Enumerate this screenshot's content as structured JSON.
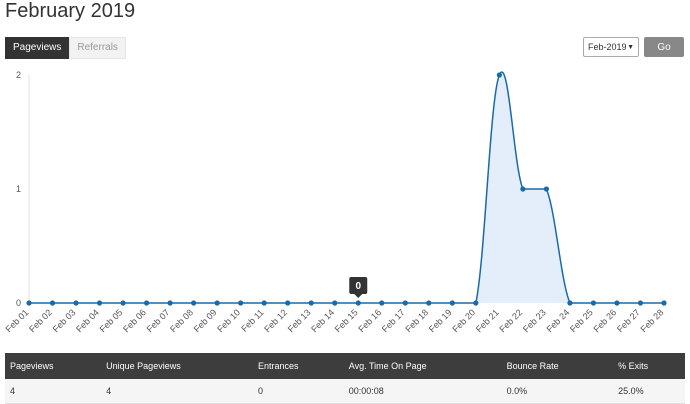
{
  "page": {
    "title": "February 2019"
  },
  "tabs": [
    {
      "label": "Pageviews",
      "active": true
    },
    {
      "label": "Referrals",
      "active": false
    }
  ],
  "controls": {
    "month_select_value": "Feb-2019",
    "go_label": "Go"
  },
  "tooltip": {
    "value": "0"
  },
  "chart_data": {
    "type": "area",
    "categories": [
      "Feb 01",
      "Feb 02",
      "Feb 03",
      "Feb 04",
      "Feb 05",
      "Feb 06",
      "Feb 07",
      "Feb 08",
      "Feb 09",
      "Feb 10",
      "Feb 11",
      "Feb 12",
      "Feb 13",
      "Feb 14",
      "Feb 15",
      "Feb 16",
      "Feb 17",
      "Feb 18",
      "Feb 19",
      "Feb 20",
      "Feb 21",
      "Feb 22",
      "Feb 23",
      "Feb 24",
      "Feb 25",
      "Feb 26",
      "Feb 27",
      "Feb 28"
    ],
    "values": [
      0,
      0,
      0,
      0,
      0,
      0,
      0,
      0,
      0,
      0,
      0,
      0,
      0,
      0,
      0,
      0,
      0,
      0,
      0,
      0,
      2,
      1,
      1,
      0,
      0,
      0,
      0,
      0
    ],
    "ylim": [
      0,
      2
    ],
    "yticks": [
      "0",
      "1",
      "2"
    ],
    "line_color": "#1a6aa8",
    "fill_color": "#e3eefa",
    "grid": false,
    "tooltip_index": 14
  },
  "summary": {
    "headers": [
      "Pageviews",
      "Unique Pageviews",
      "Entrances",
      "Avg. Time On Page",
      "Bounce Rate",
      "% Exits"
    ],
    "row": [
      "4",
      "4",
      "0",
      "00:00:08",
      "0.0%",
      "25.0%"
    ]
  }
}
